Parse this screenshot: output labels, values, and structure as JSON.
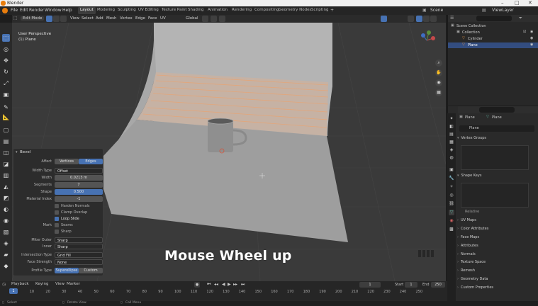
{
  "window": {
    "title": "Blender"
  },
  "menu": [
    "File",
    "Edit",
    "Render",
    "Window",
    "Help"
  ],
  "workspaces": [
    "Layout",
    "Modeling",
    "Sculpting",
    "UV Editing",
    "Texture Paint",
    "Shading",
    "Animation",
    "Rendering",
    "Compositing",
    "Geometry Nodes",
    "Scripting"
  ],
  "top_right": {
    "scene": "Scene",
    "view_layer": "ViewLayer"
  },
  "viewport_header": {
    "mode": "Edit Mode",
    "menus": [
      "View",
      "Select",
      "Add",
      "Mesh",
      "Vertex",
      "Edge",
      "Face",
      "UV"
    ],
    "orientation": "Global",
    "options": "Options"
  },
  "viewport": {
    "view_name": "User Perspective",
    "object_name": "(1) Plane",
    "gizmo": {
      "x": "X",
      "y": "Y",
      "z": "Z"
    }
  },
  "operator_panel": {
    "title": "Bevel",
    "affect_label": "Affect",
    "affect_options": [
      "Vertices",
      "Edges"
    ],
    "width_type_label": "Width Type",
    "width_type_value": "Offset",
    "width_label": "Width",
    "width_value": "0.0213 m",
    "segments_label": "Segments",
    "segments_value": "7",
    "shape_label": "Shape",
    "shape_value": "0.500",
    "material_label": "Material Index",
    "material_value": "-1",
    "checkbox_rows": [
      {
        "label": "Harden Normals",
        "checked": false
      },
      {
        "label": "Clamp Overlap",
        "checked": false
      },
      {
        "label": "Loop Slide",
        "checked": true
      }
    ],
    "mark_label": "Mark",
    "mark_options": [
      {
        "label": "Seams",
        "checked": false
      },
      {
        "label": "Sharp",
        "checked": false
      }
    ],
    "miter_outer_label": "Miter Outer",
    "miter_outer_value": "Sharp",
    "inner_label": "Inner",
    "inner_value": "Sharp",
    "intersection_label": "Intersection Type",
    "intersection_value": "Grid Fill",
    "face_strength_label": "Face Strength",
    "face_strength_value": "None",
    "profile_type_label": "Profile Type",
    "profile_type_options": [
      "Superellipse",
      "Custom"
    ]
  },
  "overlay_caption": "Mouse Wheel up",
  "outliner": {
    "rows": [
      {
        "label": "Scene Collection",
        "indent": 0
      },
      {
        "label": "Collection",
        "indent": 1
      },
      {
        "label": "Cylinder",
        "indent": 2
      },
      {
        "label": "Plane",
        "indent": 2,
        "selected": true
      }
    ]
  },
  "properties": {
    "object_name": "Plane",
    "data_name": "Plane",
    "mesh_field": "Plane",
    "sections": [
      "Vertex Groups",
      "Shape Keys",
      "UV Maps",
      "Color Attributes",
      "Face Maps",
      "Attributes",
      "Normals",
      "Texture Space",
      "Remesh",
      "Geometry Data",
      "Custom Properties"
    ],
    "auto_smooth_label": "Relative"
  },
  "timeline": {
    "menus": [
      "Playback",
      "Keying",
      "View",
      "Marker"
    ],
    "ticks": [
      "0",
      "10",
      "20",
      "30",
      "40",
      "50",
      "60",
      "70",
      "80",
      "90",
      "100",
      "110",
      "120",
      "130",
      "140",
      "150",
      "160",
      "170",
      "180",
      "190",
      "200",
      "210",
      "220",
      "230",
      "240",
      "250"
    ],
    "current_frame": "1",
    "start_label": "Start",
    "start": "1",
    "end_label": "End",
    "end": "250"
  },
  "statusbar": [
    "Select",
    "Rotate View",
    "Call Menu"
  ],
  "colors": {
    "accent": "#4772b3",
    "viewport_bg": "#3a3a3a",
    "floor": "#9a9a9a",
    "highlight": "#e0a070"
  }
}
